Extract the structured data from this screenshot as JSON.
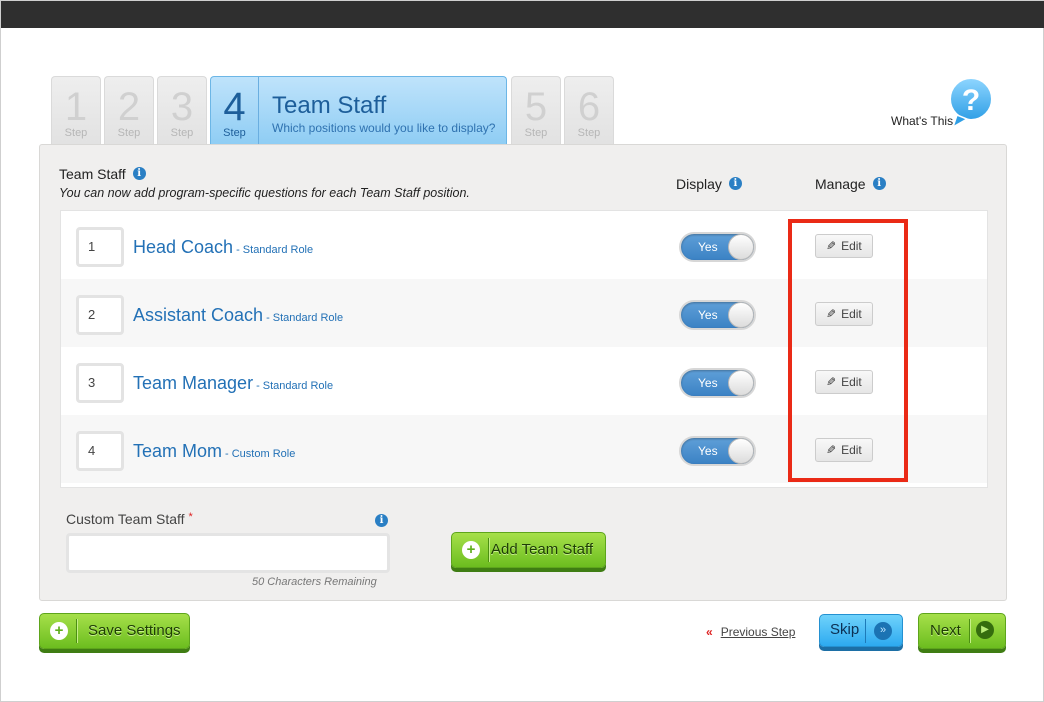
{
  "steps": [
    {
      "num": "1",
      "label": "Step"
    },
    {
      "num": "2",
      "label": "Step"
    },
    {
      "num": "3",
      "label": "Step"
    },
    {
      "num": "4",
      "label": "Step",
      "title": "Team Staff",
      "subtitle": "Which positions would you like to display?"
    },
    {
      "num": "5",
      "label": "Step"
    },
    {
      "num": "6",
      "label": "Step"
    }
  ],
  "help": {
    "label": "What's This",
    "icon": "?"
  },
  "panel": {
    "heading": "Team Staff",
    "description": "You can now add program-specific questions for each Team Staff position.",
    "col_display": "Display",
    "col_manage": "Manage",
    "info_icon": "i"
  },
  "roles": [
    {
      "order": "1",
      "name": "Head Coach",
      "type": "- Standard Role",
      "toggle": "Yes",
      "edit": "Edit"
    },
    {
      "order": "2",
      "name": "Assistant Coach",
      "type": "- Standard Role",
      "toggle": "Yes",
      "edit": "Edit"
    },
    {
      "order": "3",
      "name": "Team Manager",
      "type": "- Standard Role",
      "toggle": "Yes",
      "edit": "Edit"
    },
    {
      "order": "4",
      "name": "Team Mom",
      "type": "- Custom Role",
      "toggle": "Yes",
      "edit": "Edit"
    }
  ],
  "custom": {
    "label": "Custom Team Staff",
    "required_mark": "*",
    "value": "",
    "remaining": "50 Characters Remaining",
    "add_button": "Add Team Staff"
  },
  "footer": {
    "save": "Save Settings",
    "previous": "Previous Step",
    "previous_icon": "«",
    "skip": "Skip",
    "skip_icon": "»",
    "next": "Next",
    "next_icon": "▶"
  },
  "colors": {
    "accent_blue": "#2371b6",
    "green": "#6cbd1f",
    "skip_blue": "#2daaf0",
    "highlight_red": "#ea2a16"
  }
}
